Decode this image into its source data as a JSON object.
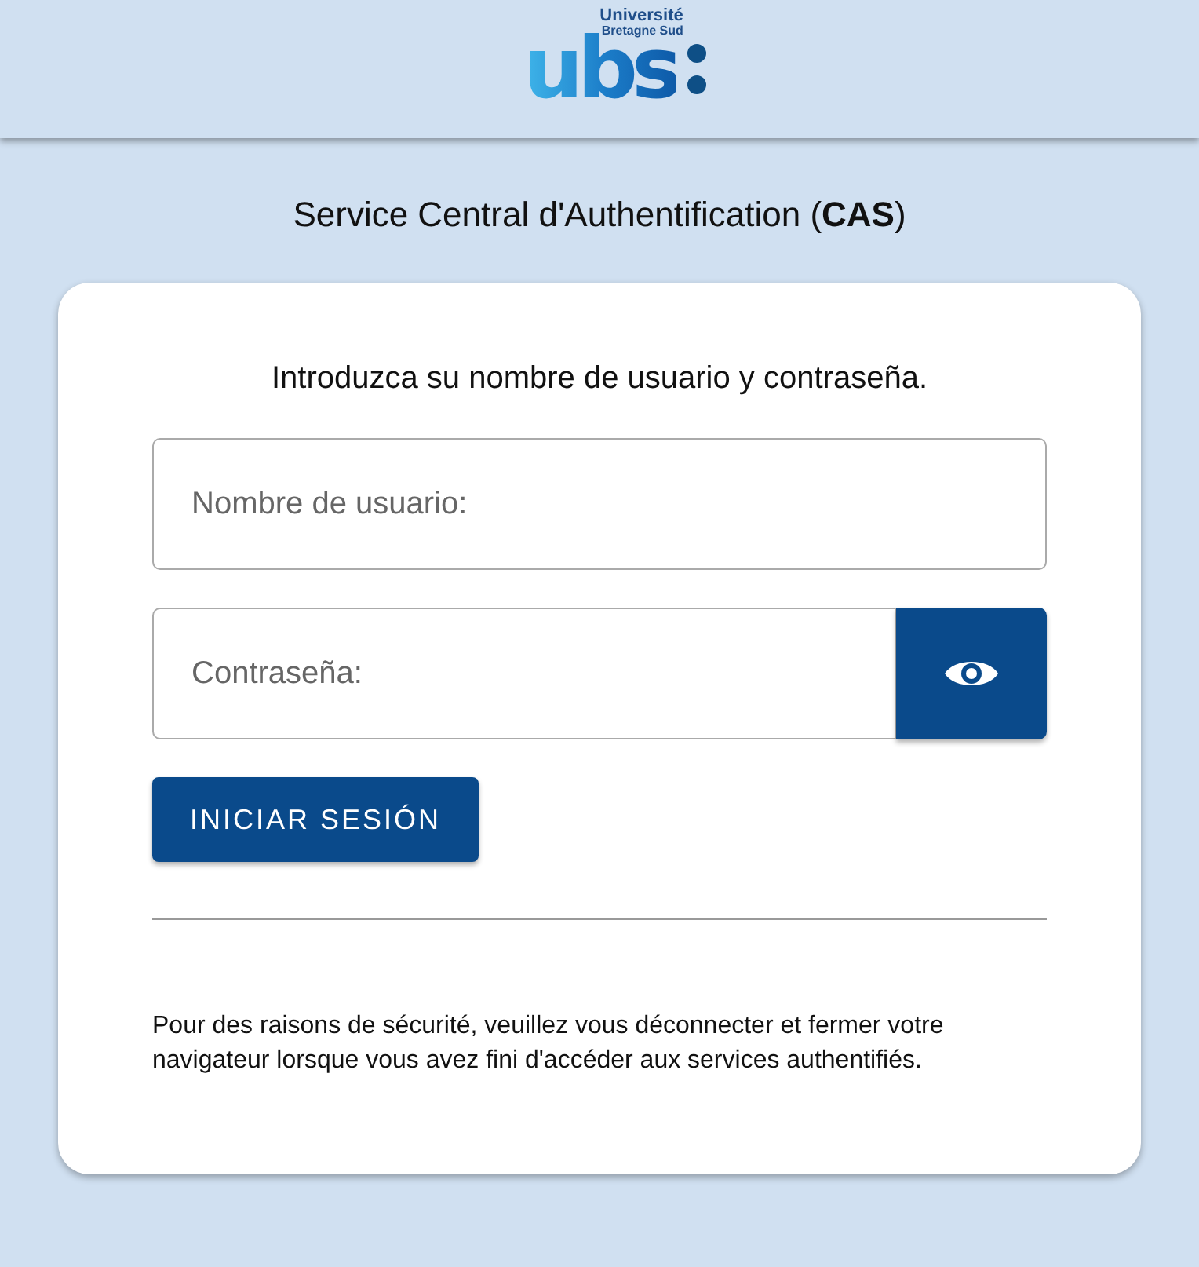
{
  "header": {
    "logo": {
      "line_1": "Université",
      "line_2": "Bretagne Sud",
      "mark": "ubs"
    }
  },
  "title": "Service Central d'Authentification (**CAS**)",
  "card": {
    "heading": "Introduzca su nombre de usuario y contraseña.",
    "username": {
      "placeholder": "Nombre de usuario:"
    },
    "password": {
      "placeholder": "Contraseña:"
    },
    "submit": "INICIAR SESIÓN",
    "notice": "Pour des raisons de sécurité, veuillez vous déconnecter et fermer votre navigateur lorsque vous avez fini d'accéder aux services authentifiés."
  }
}
